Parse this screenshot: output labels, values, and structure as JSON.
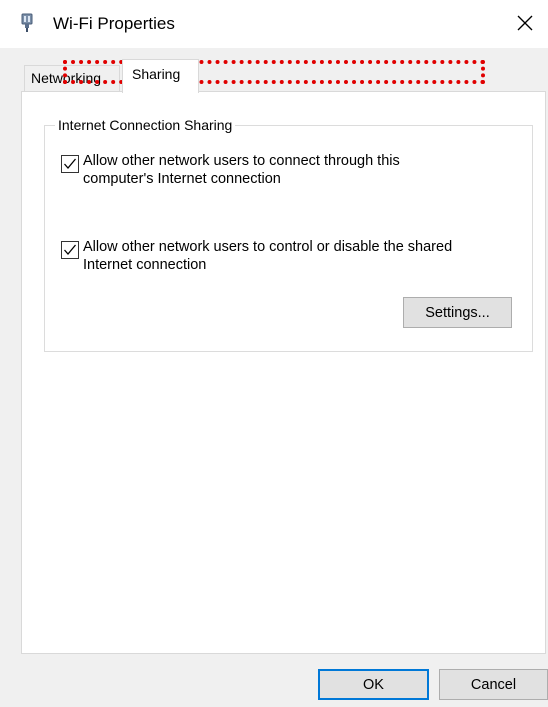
{
  "window": {
    "title": "Wi-Fi Properties",
    "close_symbol": "✕"
  },
  "tabs": [
    {
      "label": "Networking",
      "selected": false
    },
    {
      "label": "Sharing",
      "selected": true
    }
  ],
  "sharing": {
    "group_label": "Internet Connection Sharing",
    "allow_connect": {
      "checked": true,
      "label": "Allow other network users to connect through this computer's Internet connection"
    },
    "allow_control": {
      "checked": true,
      "label": "Allow other network users to control or disable the shared Internet connection"
    },
    "settings_label": "Settings..."
  },
  "footer": {
    "ok_label": "OK",
    "cancel_label": "Cancel"
  },
  "colors": {
    "focus_highlight": "#e00000",
    "default_button_border": "#0078d7",
    "dialog_background": "#f0f0f0"
  }
}
